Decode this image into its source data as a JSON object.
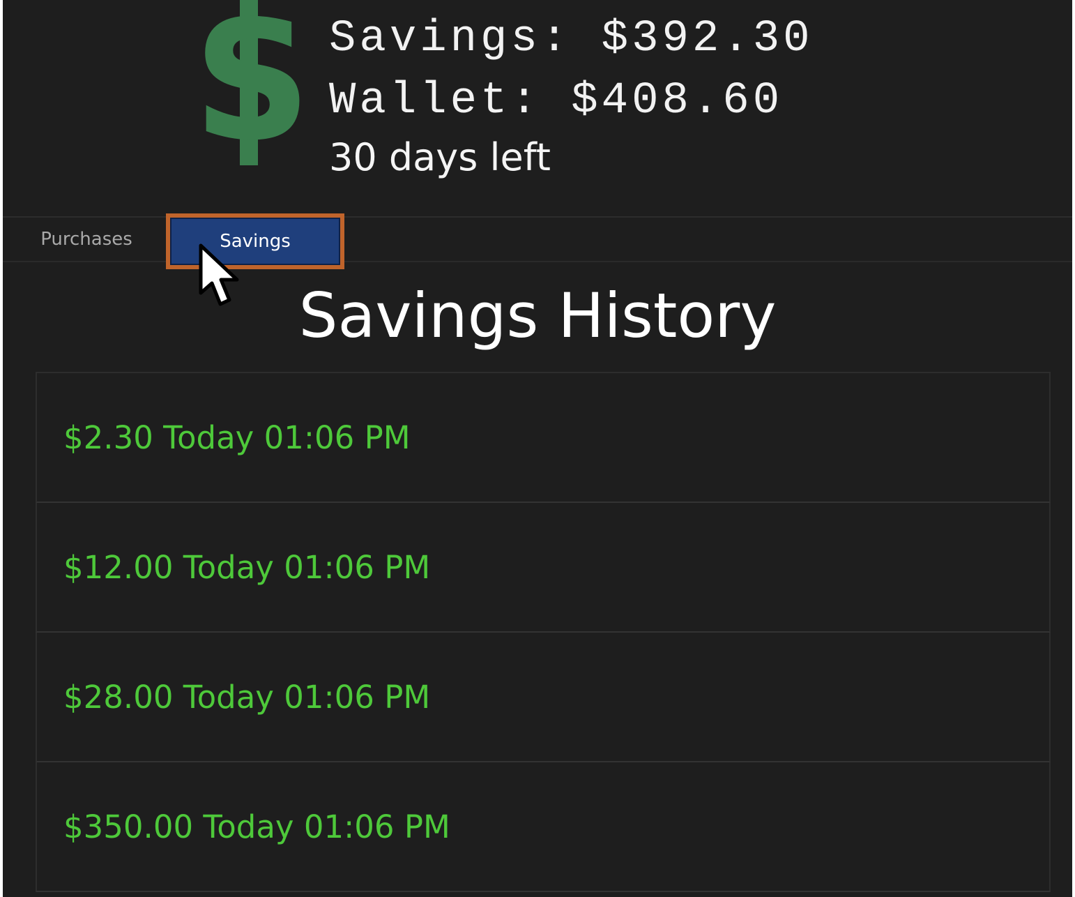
{
  "header": {
    "logo_icon": "dollar-sign-icon",
    "logo_color": "#3a7f4e",
    "savings_text": "Savings: $392.30",
    "wallet_text": "Wallet: $408.60",
    "days_left_text": "30 days left"
  },
  "tabs": {
    "purchases_label": "Purchases",
    "savings_label": "Savings",
    "active": "Savings",
    "active_color": "#1f3f7c",
    "highlight_color": "#c0642b"
  },
  "main": {
    "title": "Savings History",
    "entry_color": "#4ec93a",
    "entries": [
      "$2.30 Today 01:06 PM",
      "$12.00 Today 01:06 PM",
      "$28.00 Today 01:06 PM",
      "$350.00 Today 01:06 PM"
    ]
  }
}
